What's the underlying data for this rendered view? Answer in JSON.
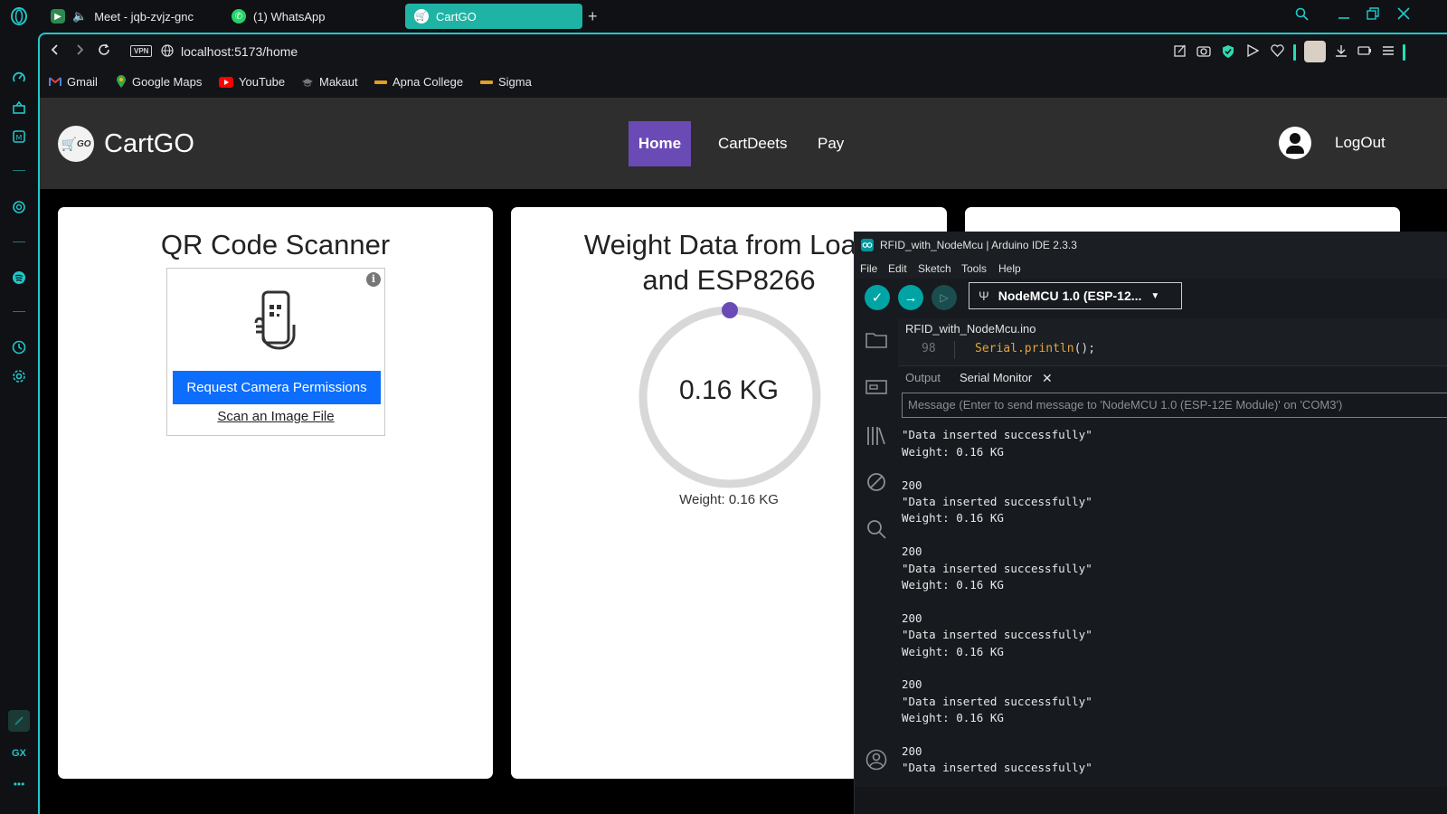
{
  "browser": {
    "tabs": [
      {
        "label": "Meet - jqb-zvjz-gnc"
      },
      {
        "label": "(1) WhatsApp"
      },
      {
        "label": "CartGO"
      }
    ],
    "url": "localhost:5173/home",
    "vpn_label": "VPN",
    "bookmarks": [
      {
        "label": "Gmail"
      },
      {
        "label": "Google Maps"
      },
      {
        "label": "YouTube"
      },
      {
        "label": "Makaut"
      },
      {
        "label": "Apna College"
      },
      {
        "label": "Sigma"
      }
    ],
    "sidebar_gx_label": "GX",
    "sidebar_more_label": "•••"
  },
  "app": {
    "brand": "CartGO",
    "logo_text": "GO",
    "nav": [
      {
        "label": "Home"
      },
      {
        "label": "CartDeets"
      },
      {
        "label": "Pay"
      }
    ],
    "logout_label": "LogOut",
    "qr_card": {
      "title": "QR Code Scanner",
      "info_label": "i",
      "request_button": "Request Camera Permissions",
      "scan_link": "Scan an Image File"
    },
    "weight_card": {
      "title_line1": "Weight Data from Load",
      "title_line2": "and ESP8266",
      "gauge_value": "0.16 KG",
      "caption": "Weight: 0.16 KG",
      "accent_color": "#6a4bb6"
    }
  },
  "ide": {
    "title": "RFID_with_NodeMcu | Arduino IDE 2.3.3",
    "menu": [
      {
        "label": "File"
      },
      {
        "label": "Edit"
      },
      {
        "label": "Sketch"
      },
      {
        "label": "Tools"
      },
      {
        "label": "Help"
      }
    ],
    "board": "NodeMCU 1.0 (ESP-12...",
    "file_tab": "RFID_with_NodeMcu.ino",
    "line_number": "98",
    "code_object": "Serial",
    "code_method": ".println",
    "code_rest": "();",
    "output_tab": "Output",
    "serial_tab": "Serial Monitor",
    "message_placeholder": "Message (Enter to send message to 'NodeMCU 1.0 (ESP-12E Module)' on 'COM3')",
    "log_partial": "\"Data inserted successfully\"",
    "log_weight": "Weight: 0.16 KG",
    "log_code": "200",
    "log_inserted": "\"Data inserted successfully\""
  }
}
